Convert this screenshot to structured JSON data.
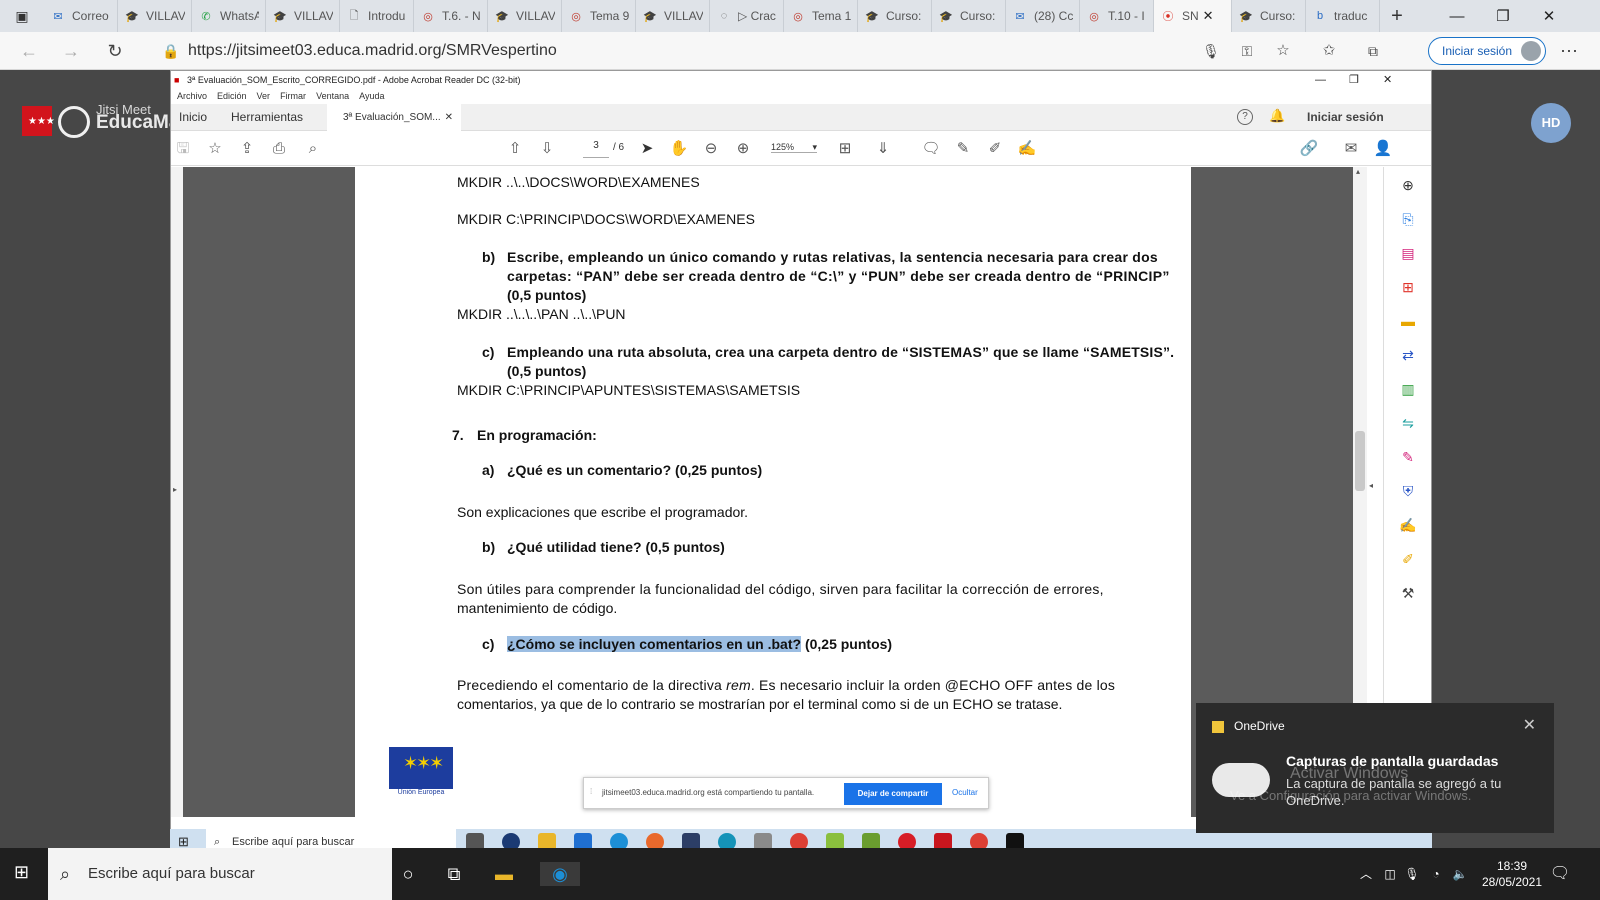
{
  "browser": {
    "tabs": [
      {
        "label": "Correo",
        "icon": "mail-icon",
        "active": false
      },
      {
        "label": "VILLAV",
        "icon": "moodle-icon",
        "active": false
      },
      {
        "label": "WhatsA",
        "icon": "whatsapp-icon",
        "active": false
      },
      {
        "label": "VILLAV",
        "icon": "moodle-icon",
        "active": false
      },
      {
        "label": "Introdu",
        "icon": "document-icon",
        "active": false
      },
      {
        "label": "T.6. - N",
        "icon": "educa-icon",
        "active": false
      },
      {
        "label": "VILLAV",
        "icon": "moodle-icon",
        "active": false
      },
      {
        "label": "Tema 9",
        "icon": "educa-icon",
        "active": false
      },
      {
        "label": "VILLAV",
        "icon": "moodle-icon",
        "active": false
      },
      {
        "label": "▷ Crac",
        "icon": "loading-icon",
        "active": false
      },
      {
        "label": "Tema 1",
        "icon": "educa-icon",
        "active": false
      },
      {
        "label": "Curso:",
        "icon": "cap-icon",
        "active": false
      },
      {
        "label": "Curso:",
        "icon": "moodle-icon",
        "active": false
      },
      {
        "label": "(28) Cc",
        "icon": "mail-icon",
        "active": false
      },
      {
        "label": "T.10 - I",
        "icon": "educa-icon",
        "active": false
      },
      {
        "label": "SN",
        "icon": "record-icon",
        "active": true
      },
      {
        "label": "Curso:",
        "icon": "cap-icon",
        "active": false
      },
      {
        "label": "traduc",
        "icon": "bing-icon",
        "active": false
      }
    ],
    "url": "https://jitsimeet03.educa.madrid.org/SMRVespertino",
    "login_label": "Iniciar sesión"
  },
  "jitsi": {
    "brand_small": "Jitsi Meet",
    "brand_big": "EducaMadrid",
    "avatar_initials": "HD"
  },
  "acrobat": {
    "title": "3ª Evaluación_SOM_Escrito_CORREGIDO.pdf - Adobe Acrobat Reader DC (32-bit)",
    "menu": [
      "Archivo",
      "Edición",
      "Ver",
      "Firmar",
      "Ventana",
      "Ayuda"
    ],
    "tabs": {
      "home": "Inicio",
      "tools": "Herramientas",
      "doc": "3ª Evaluación_SOM..."
    },
    "signin": "Iniciar sesión",
    "page_current": "3",
    "page_total": "/ 6",
    "zoom": "125%"
  },
  "document": {
    "lines": {
      "l1": "MKDIR ..\\..\\DOCS\\WORD\\EXAMENES",
      "l2": "MKDIR C:\\PRINCIP\\DOCS\\WORD\\EXAMENES",
      "b_marker": "b)",
      "b_q1": "Escribe, empleando un único comando y rutas relativas, la sentencia necesaria para crear dos",
      "b_q2": "carpetas: “PAN” debe ser creada dentro de “C:\\” y “PUN” debe ser creada dentro de “PRINCIP”",
      "b_q3": "(0,5 puntos)",
      "b_ans": "MKDIR ..\\..\\..\\PAN ..\\..\\PUN",
      "c_marker": "c)",
      "c_q1": "Empleando una ruta absoluta, crea una carpeta dentro de “SISTEMAS” que se llame “SAMETSIS”.",
      "c_q2": "(0,5 puntos)",
      "c_ans": "MKDIR C:\\PRINCIP\\APUNTES\\SISTEMAS\\SAMETSIS",
      "s7_num": "7.",
      "s7_title": "En programación:",
      "a7_marker": "a)",
      "a7_q": "¿Qué es un comentario? (0,25 puntos)",
      "a7_ans": "Son explicaciones que escribe el programador.",
      "b7_marker": "b)",
      "b7_q": "¿Qué utilidad tiene? (0,5 puntos)",
      "b7_ans1": "Son útiles para comprender la funcionalidad del código, sirven para facilitar la corrección de errores,",
      "b7_ans2": "mantenimiento de código.",
      "c7_marker": "c)",
      "c7_q_hl": "¿Cómo se incluyen comentarios en un .bat?",
      "c7_q_rest": " (0,25 puntos)",
      "c7_ans1a": "Precediendo el comentario de la directiva ",
      "c7_ans1b": "rem",
      "c7_ans1c": ". Es necesario incluir la orden @ECHO OFF antes de los",
      "c7_ans2": "comentarios, ya que de lo contrario se mostrarían por el terminal como si de un ECHO se tratase."
    },
    "eu_label": "Unión Europea"
  },
  "share_bar": {
    "message": "jitsimeet03.educa.madrid.org está compartiendo tu pantalla.",
    "stop": "Dejar de compartir",
    "hide": "Ocultar"
  },
  "inner_taskbar": {
    "search": "Escribe aquí para buscar"
  },
  "toast": {
    "app": "OneDrive",
    "title": "Capturas de pantalla guardadas",
    "body": "La captura de pantalla se agregó a tu OneDrive.",
    "watermark_1": "Activar Windows",
    "watermark_2": "Ve a Configuración para activar Windows."
  },
  "taskbar": {
    "search": "Escribe aquí para buscar",
    "time": "18:39",
    "date": "28/05/2021"
  }
}
